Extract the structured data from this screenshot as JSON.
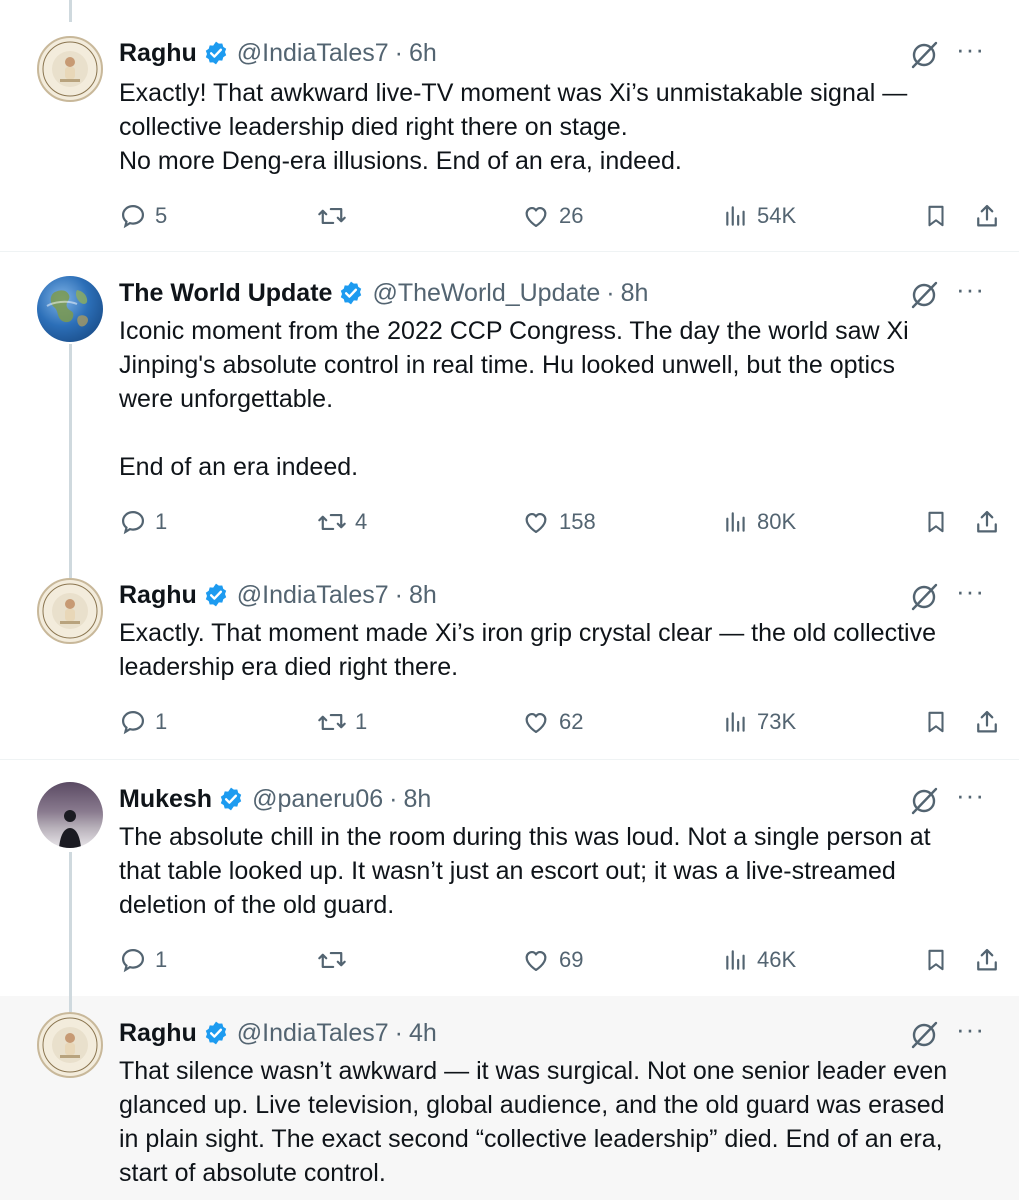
{
  "tweets": [
    {
      "name": "Raghu",
      "handle": "@IndiaTales7",
      "separator": "·",
      "time": "6h",
      "text": "Exactly! That awkward live-TV moment was Xi’s unmistakable signal —\ncollective leadership died right there on stage.\nNo more Deng-era illusions. End of an era, indeed.",
      "replies": "5",
      "reposts": "",
      "likes": "26",
      "views": "54K"
    },
    {
      "name": "The World Update",
      "handle": "@TheWorld_Update",
      "separator": "·",
      "time": "8h",
      "text": "Iconic moment from the 2022 CCP Congress. The day the world saw Xi\nJinping's absolute control in real time. Hu looked unwell, but the optics\nwere unforgettable.\n\nEnd of an era indeed.",
      "replies": "1",
      "reposts": "4",
      "likes": "158",
      "views": "80K"
    },
    {
      "name": "Raghu",
      "handle": "@IndiaTales7",
      "separator": "·",
      "time": "8h",
      "text": "Exactly. That moment made Xi’s iron grip crystal clear — the old collective\nleadership era died right there.",
      "replies": "1",
      "reposts": "1",
      "likes": "62",
      "views": "73K"
    },
    {
      "name": "Mukesh",
      "handle": "@paneru06",
      "separator": "·",
      "time": "8h",
      "text": "The absolute chill in the room during this was loud. Not a single person at\nthat table looked up. It wasn’t just an escort out; it was a live-streamed\ndeletion of the old guard.",
      "replies": "1",
      "reposts": "",
      "likes": "69",
      "views": "46K"
    },
    {
      "name": "Raghu",
      "handle": "@IndiaTales7",
      "separator": "·",
      "time": "4h",
      "text": "That silence wasn’t awkward — it was surgical. Not one senior leader even\nglanced up. Live television, global audience, and the old guard was erased\nin plain sight. The exact second “collective leadership” died. End of an era,\nstart of absolute control."
    }
  ],
  "more_label": "···",
  "avatar_text": {
    "india_tales": "INDIA TALES 7"
  },
  "icons": {
    "verified": "verified-badge-icon",
    "grok": "grok-icon",
    "reply": "reply-icon",
    "repost": "repost-icon",
    "like": "like-icon",
    "views": "views-icon",
    "bookmark": "bookmark-icon",
    "share": "share-icon"
  },
  "colors": {
    "verified_blue": "#1d9bf0",
    "secondary_text": "#536471",
    "thread_line": "#cfd9de",
    "highlight_bg": "#f7f7f7"
  }
}
